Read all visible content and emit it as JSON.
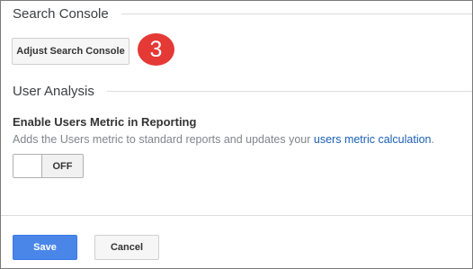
{
  "search_console": {
    "section_title": "Search Console",
    "adjust_button_label": "Adjust Search Console",
    "step_badge": "3"
  },
  "user_analysis": {
    "section_title": "User Analysis",
    "setting_title": "Enable Users Metric in Reporting",
    "setting_desc_prefix": "Adds the Users metric to standard reports and updates your ",
    "setting_desc_link": "users metric calculation",
    "setting_desc_suffix": ".",
    "toggle_state": "OFF"
  },
  "footer": {
    "save_label": "Save",
    "cancel_label": "Cancel"
  },
  "colors": {
    "primary": "#4a86e8",
    "badge": "#e53935",
    "link": "#1a5fb4"
  }
}
